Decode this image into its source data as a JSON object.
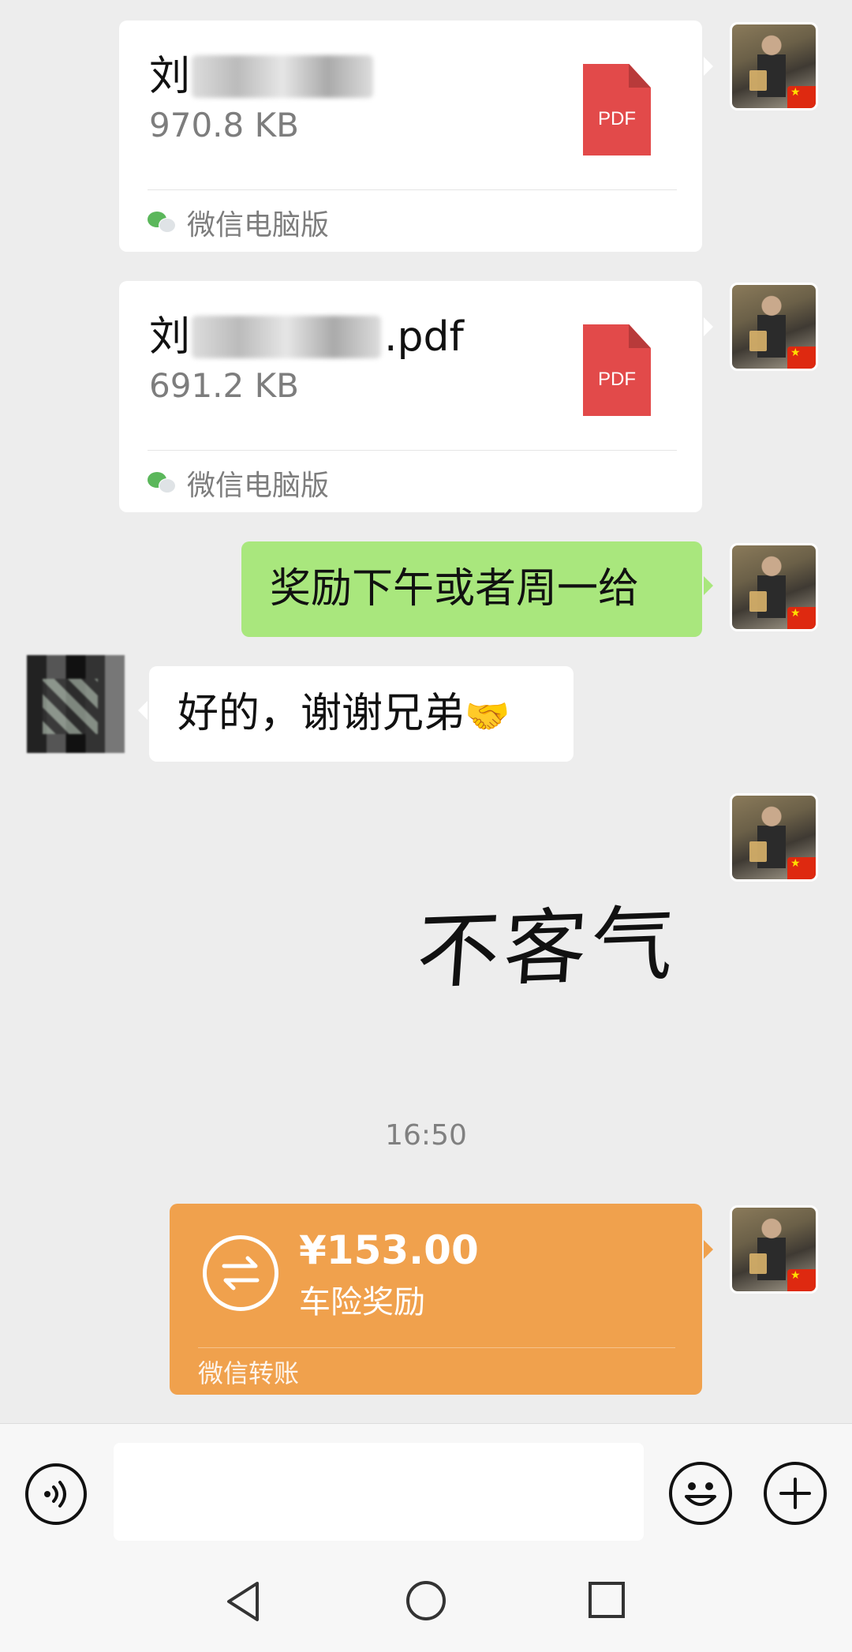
{
  "messages": {
    "file1": {
      "name_prefix": "刘",
      "name_suffix": "",
      "size": "970.8 KB",
      "type_label": "PDF",
      "source": "微信电脑版"
    },
    "file2": {
      "name_prefix": "刘",
      "name_suffix": ".pdf",
      "size": "691.2 KB",
      "type_label": "PDF",
      "source": "微信电脑版"
    },
    "text_me": "奖励下午或者周一给",
    "text_friend": "好的，谢谢兄弟",
    "text_friend_emoji": "🤝",
    "sticker_text": "不客气",
    "timestamp": "16:50",
    "transfer": {
      "amount": "¥153.00",
      "note": "车险奖励",
      "source": "微信转账"
    }
  },
  "input": {
    "placeholder": ""
  },
  "icons": {
    "voice": "voice-icon",
    "emoji": "emoji-icon",
    "plus": "plus-icon",
    "nav_back": "nav-back-icon",
    "nav_home": "nav-home-icon",
    "nav_recent": "nav-recent-icon"
  },
  "colors": {
    "background": "#ededed",
    "bubble_me": "#a9e77d",
    "bubble_friend": "#ffffff",
    "transfer": "#f0a14d",
    "pdf": "#e24a4a"
  }
}
